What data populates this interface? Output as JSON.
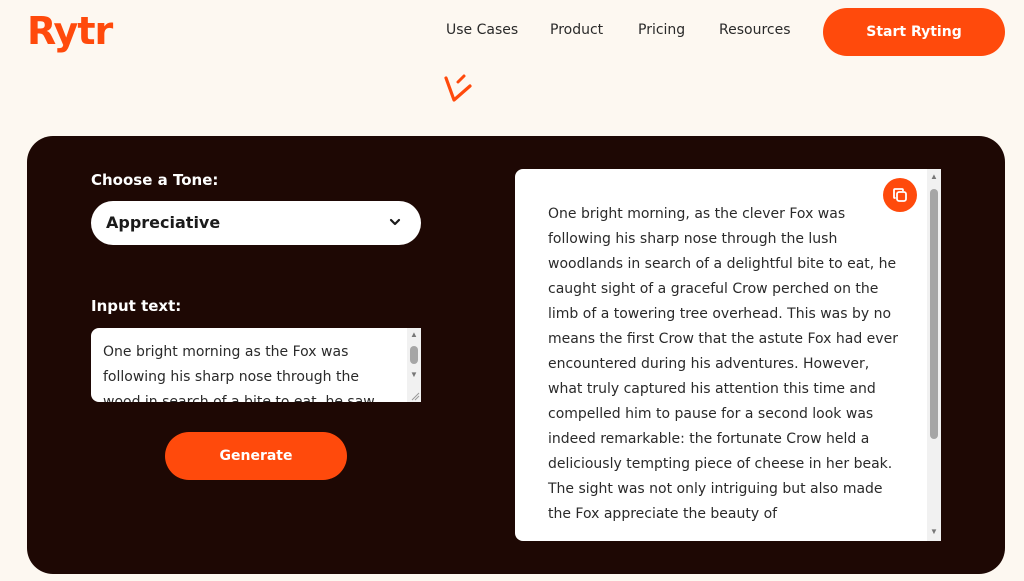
{
  "brand": {
    "logo_text": "Rytr",
    "accent_color": "#ff4a0c",
    "panel_color": "#1e0804"
  },
  "nav": {
    "items": [
      {
        "label": "Use Cases"
      },
      {
        "label": "Product"
      },
      {
        "label": "Pricing"
      },
      {
        "label": "Resources"
      }
    ],
    "cta_label": "Start Ryting"
  },
  "form": {
    "tone_label": "Choose a Tone:",
    "tone_value": "Appreciative",
    "input_label": "Input text:",
    "input_text": "One bright morning as the Fox was following his sharp nose through the wood in search of a bite to eat, he saw",
    "generate_label": "Generate"
  },
  "output": {
    "text": "One bright morning, as the clever Fox was following his sharp nose through the lush woodlands in search of a delightful bite to eat, he caught sight of a graceful Crow perched on the limb of a towering tree overhead. This was by no means the first Crow that the astute Fox had ever encountered during his adventures. However, what truly captured his attention this time and compelled him to pause for a second look was indeed remarkable: the fortunate Crow held a deliciously tempting piece of cheese in her beak. The sight was not only intriguing but also made the Fox appreciate the beauty of",
    "copy_icon": "copy-icon"
  }
}
